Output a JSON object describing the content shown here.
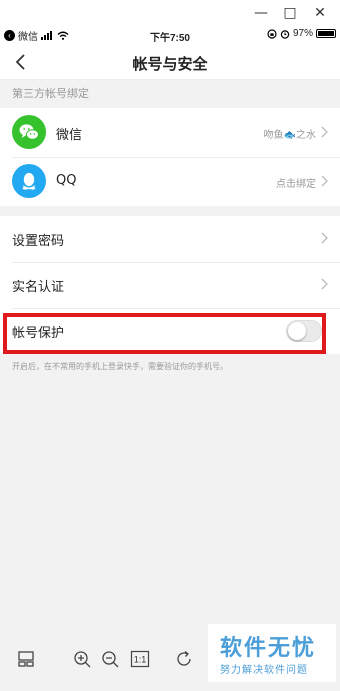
{
  "window": {
    "minimize": "—",
    "maximize": "□",
    "close": "✕"
  },
  "status_bar": {
    "carrier": "微信",
    "time": "下午7:50",
    "battery": "97%"
  },
  "nav": {
    "title": "帐号与安全"
  },
  "third_party": {
    "header": "第三方帐号绑定",
    "items": [
      {
        "label": "微信",
        "value": "吻鱼🐟之水",
        "icon": "wechat-icon",
        "color": "#35c22d"
      },
      {
        "label": "QQ",
        "value": "点击绑定",
        "icon": "qq-icon",
        "color": "#22a9f2"
      }
    ]
  },
  "settings": {
    "items": [
      {
        "label": "设置密码"
      },
      {
        "label": "实名认证"
      }
    ]
  },
  "protection": {
    "label": "帐号保护",
    "enabled": false,
    "hint": "开启后，在不常用的手机上登录快手，需要验证你的手机号。"
  },
  "toolbar": {
    "zoom_reset": "1:1"
  },
  "watermark": {
    "title": "软件无忧",
    "subtitle": "努力解决软件问题"
  },
  "colors": {
    "highlight": "#e0191c",
    "background": "#f2f2f2",
    "watermark": "#4c9ed8"
  }
}
